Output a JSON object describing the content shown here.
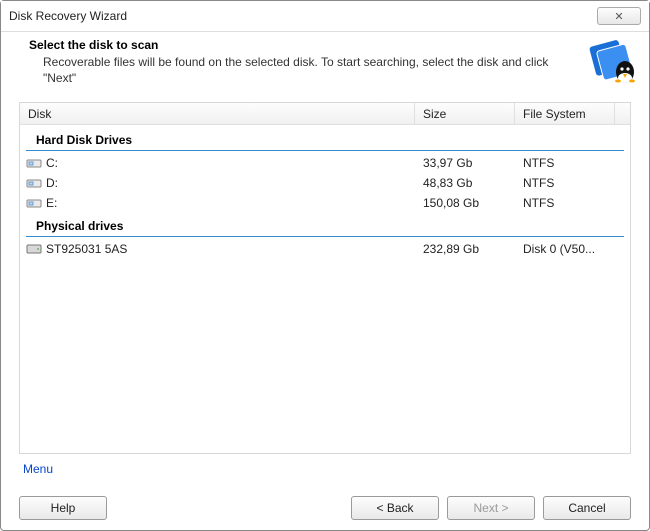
{
  "window": {
    "title": "Disk Recovery Wizard",
    "close_glyph": "✕"
  },
  "header": {
    "heading": "Select the disk to scan",
    "subtext": "Recoverable files will be found on the selected disk. To start searching, select the disk and click \"Next\""
  },
  "columns": {
    "disk": "Disk",
    "size": "Size",
    "fs": "File System"
  },
  "groups": {
    "hdd": "Hard Disk Drives",
    "phys": "Physical drives"
  },
  "drives": {
    "hdd": [
      {
        "name": "C:",
        "size": "33,97 Gb",
        "fs": "NTFS"
      },
      {
        "name": "D:",
        "size": "48,83 Gb",
        "fs": "NTFS"
      },
      {
        "name": "E:",
        "size": "150,08 Gb",
        "fs": "NTFS"
      }
    ],
    "phys": [
      {
        "name": "ST925031 5AS",
        "size": "232,89 Gb",
        "fs": "Disk 0 (V50..."
      }
    ]
  },
  "menu": {
    "label": "Menu"
  },
  "buttons": {
    "help": "Help",
    "back": "< Back",
    "next": "Next >",
    "cancel": "Cancel"
  }
}
